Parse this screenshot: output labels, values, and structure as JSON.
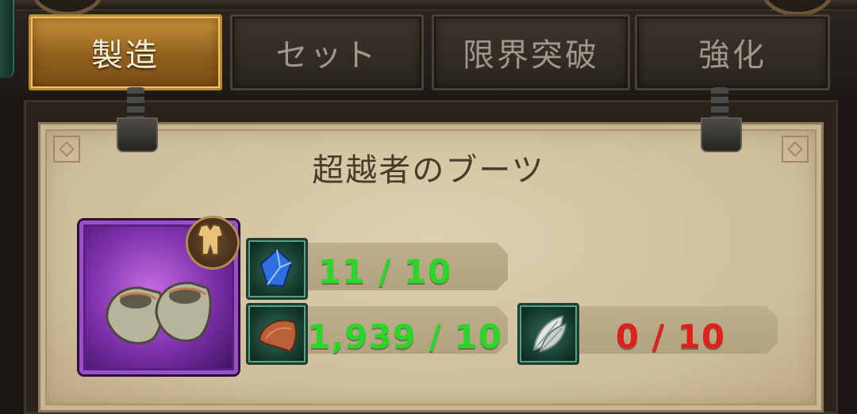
{
  "tabs": [
    {
      "label": "製造",
      "active": true
    },
    {
      "label": "セット",
      "active": false
    },
    {
      "label": "限界突破",
      "active": false
    },
    {
      "label": "強化",
      "active": false
    }
  ],
  "item": {
    "name": "超越者のブーツ",
    "icon": "boots-icon",
    "type_badge_icon": "armor-icon",
    "rarity_color": "#9a4fc7"
  },
  "materials": [
    {
      "icon": "blue-gem-icon",
      "count": "11 / 10",
      "status": "sufficient",
      "color": "#2bd62b"
    },
    {
      "icon": "leather-hide-icon",
      "count": "1,939 / 10",
      "status": "sufficient",
      "color": "#2bd62b"
    },
    {
      "icon": "feather-icon",
      "count": "0 / 10",
      "status": "insufficient",
      "color": "#e0201c"
    }
  ]
}
